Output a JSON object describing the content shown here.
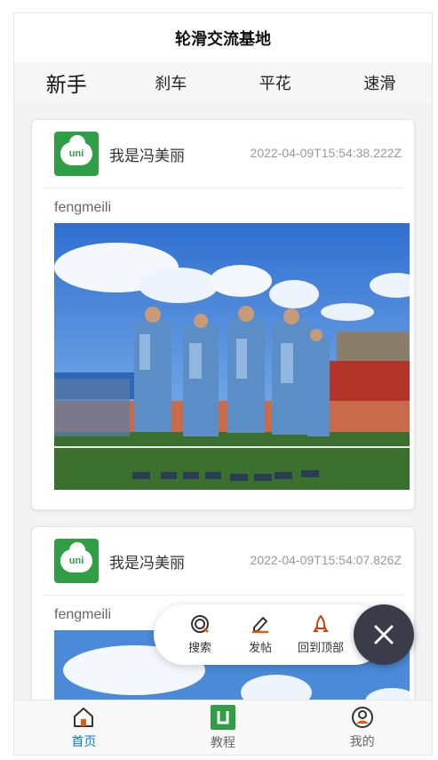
{
  "header": {
    "title": "轮滑交流基地"
  },
  "tabs": [
    {
      "label": "新手",
      "active": true
    },
    {
      "label": "刹车",
      "active": false
    },
    {
      "label": "平花",
      "active": false
    },
    {
      "label": "速滑",
      "active": false
    }
  ],
  "posts": [
    {
      "avatar_text": "uni",
      "author": "我是冯美丽",
      "time": "2022-04-09T15:54:38.222Z",
      "text": "fengmeili",
      "image": "group-photo-students-in-camouflage"
    },
    {
      "avatar_text": "uni",
      "author": "我是冯美丽",
      "time": "2022-04-09T15:54:07.826Z",
      "text": "fengmeili",
      "image": "sky-photo"
    }
  ],
  "fab": {
    "items": [
      {
        "label": "搜索",
        "icon": "search-icon"
      },
      {
        "label": "发帖",
        "icon": "pencil-icon"
      },
      {
        "label": "回到顶部",
        "icon": "rocket-icon"
      }
    ],
    "close_icon": "close-icon"
  },
  "tabbar": {
    "items": [
      {
        "label": "首页",
        "icon": "home-icon",
        "active": true
      },
      {
        "label": "教程",
        "icon": "tutorial-icon",
        "active": false
      },
      {
        "label": "我的",
        "icon": "profile-icon",
        "active": false
      }
    ]
  },
  "colors": {
    "accent": "#007aff",
    "brand_green": "#2f9e44",
    "fab_dark": "#3b3c49",
    "icon_orange": "#e8590c"
  }
}
